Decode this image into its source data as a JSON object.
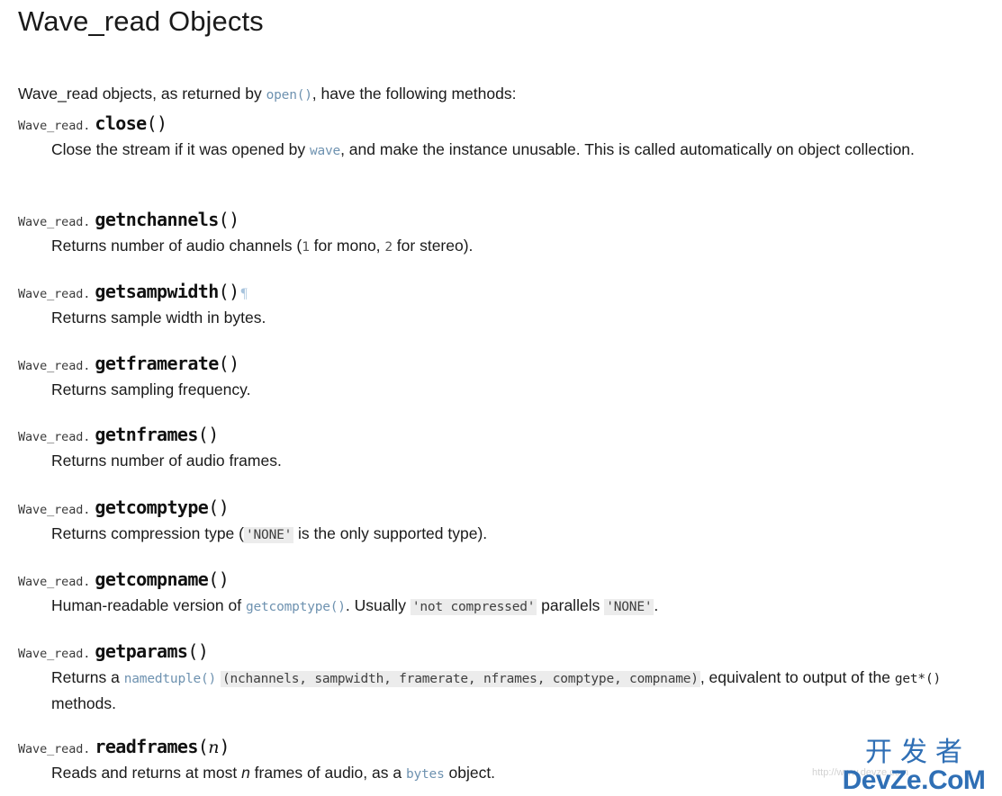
{
  "page": {
    "title": "Wave_read Objects",
    "intro": {
      "before": "Wave_read objects, as returned by ",
      "link": "open()",
      "after": ", have the following methods:"
    }
  },
  "class_prefix": "Wave_read.",
  "headerlink_glyph": "¶",
  "methods": [
    {
      "prefix": "Wave_read.",
      "name": "close",
      "signature_open": "(",
      "param": "",
      "signature_close": ")",
      "has_headerlink": false,
      "desc": {
        "p1": "Close the stream if it was opened by ",
        "code1": "wave",
        "p2": ", and make the instance unusable. This is called automatically on object collection."
      }
    },
    {
      "prefix": "Wave_read.",
      "name": "getnchannels",
      "signature_open": "(",
      "param": "",
      "signature_close": ")",
      "has_headerlink": false,
      "desc": {
        "p1": "Returns number of audio channels (",
        "code1": "1",
        "p2": " for mono, ",
        "code2": "2",
        "p3": " for stereo)."
      }
    },
    {
      "prefix": "Wave_read.",
      "name": "getsampwidth",
      "signature_open": "(",
      "param": "",
      "signature_close": ")",
      "has_headerlink": true,
      "desc": {
        "p1": "Returns sample width in bytes."
      }
    },
    {
      "prefix": "Wave_read.",
      "name": "getframerate",
      "signature_open": "(",
      "param": "",
      "signature_close": ")",
      "has_headerlink": false,
      "desc": {
        "p1": "Returns sampling frequency."
      }
    },
    {
      "prefix": "Wave_read.",
      "name": "getnframes",
      "signature_open": "(",
      "param": "",
      "signature_close": ")",
      "has_headerlink": false,
      "desc": {
        "p1": "Returns number of audio frames."
      }
    },
    {
      "prefix": "Wave_read.",
      "name": "getcomptype",
      "signature_open": "(",
      "param": "",
      "signature_close": ")",
      "has_headerlink": false,
      "desc": {
        "p1": "Returns compression type (",
        "code1": "'NONE'",
        "p2": " is the only supported type)."
      }
    },
    {
      "prefix": "Wave_read.",
      "name": "getcompname",
      "signature_open": "(",
      "param": "",
      "signature_close": ")",
      "has_headerlink": false,
      "desc": {
        "p1": "Human-readable version of ",
        "code1": "getcomptype()",
        "p2": ". Usually ",
        "code2": "'not compressed'",
        "p3": " parallels ",
        "code3": "'NONE'",
        "p4": "."
      }
    },
    {
      "prefix": "Wave_read.",
      "name": "getparams",
      "signature_open": "(",
      "param": "",
      "signature_close": ")",
      "has_headerlink": false,
      "desc": {
        "p1": "Returns a ",
        "code1": "namedtuple()",
        "p2": " ",
        "code2": "(nchannels, sampwidth, framerate, nframes, comptype, compname)",
        "p3": ", equivalent to output of the ",
        "code3": "get*()",
        "p4": " methods."
      }
    },
    {
      "prefix": "Wave_read.",
      "name": "readframes",
      "signature_open": "(",
      "param": "n",
      "signature_close": ")",
      "has_headerlink": false,
      "desc": {
        "p1": "Reads and returns at most ",
        "em1": "n",
        "p2": " frames of audio, as a ",
        "code1": "bytes",
        "p3": " object."
      }
    }
  ],
  "watermark": {
    "chinese": "开发者",
    "latin": "DevZe.CoM",
    "faint_url": "http://www.devze.com"
  },
  "colors": {
    "text": "#1a1a1a",
    "link": "#6e92b0",
    "literal_bg": "#ececec",
    "headerlink": "#a8c4dd",
    "watermark": "#2f6fb5"
  }
}
